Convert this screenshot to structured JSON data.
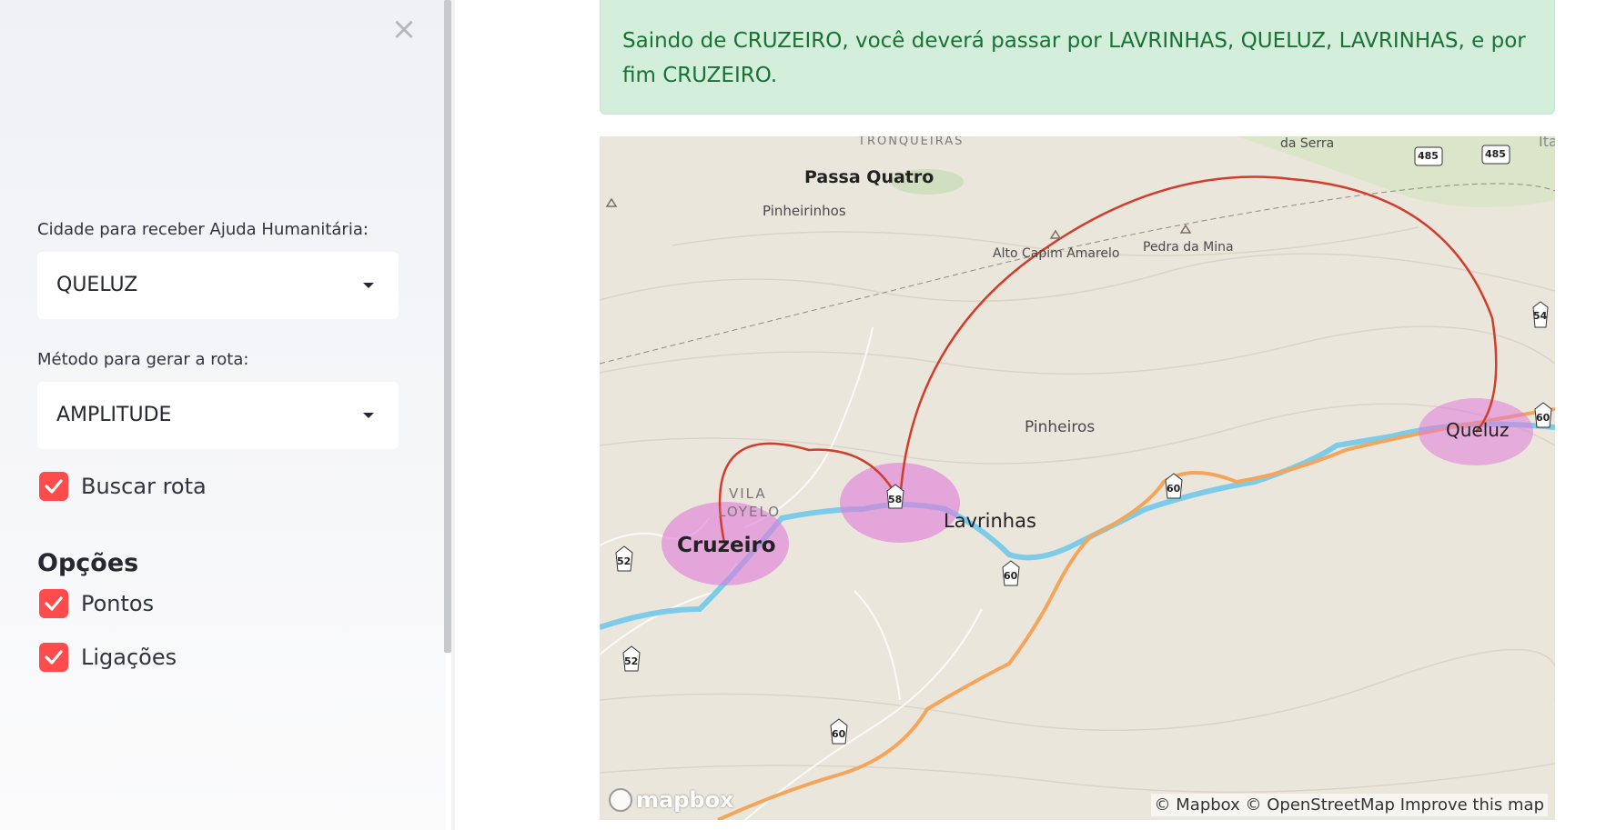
{
  "sidebar": {
    "close_icon": "×",
    "city_label": "Cidade para receber Ajuda Humanitária:",
    "city_value": "QUELUZ",
    "method_label": "Método para gerar a rota:",
    "method_value": "AMPLITUDE",
    "search_route_label": "Buscar rota",
    "search_route_checked": true,
    "options_heading": "Opções",
    "points_label": "Pontos",
    "points_checked": true,
    "links_label": "Ligações",
    "links_checked": true
  },
  "alert": {
    "text": "Saindo de CRUZEIRO, você deverá passar por LAVRINHAS, QUELUZ, LAVRINHAS, e por fim CRUZEIRO."
  },
  "map": {
    "places": {
      "tronqueiras": "TRONQUEIRAS",
      "da_serra": "da Serra",
      "ita": "Ita",
      "passa_quatro": "Passa Quatro",
      "pinheirinhos": "Pinheirinhos",
      "alto_capim_amarelo": "Alto Capim Amarelo",
      "pedra_da_mina": "Pedra da Mina",
      "pinheiros": "Pinheiros",
      "vila": "VILA",
      "loyelo": "LOYELO",
      "cruzeiro": "Cruzeiro",
      "lavrinhas": "Lavrinhas",
      "queluz": "Queluz"
    },
    "road_shields": [
      "485",
      "485",
      "54",
      "60",
      "60",
      "60",
      "60",
      "58",
      "52",
      "52"
    ],
    "logo_text": "mapbox",
    "attribution": "© Mapbox © OpenStreetMap Improve this map",
    "colors": {
      "route_arc": "#d23c2a",
      "city_point": "#e07ad8",
      "river": "#7ccbe8",
      "highway": "#f5a55a",
      "terrain": "#ebe6dc"
    }
  }
}
